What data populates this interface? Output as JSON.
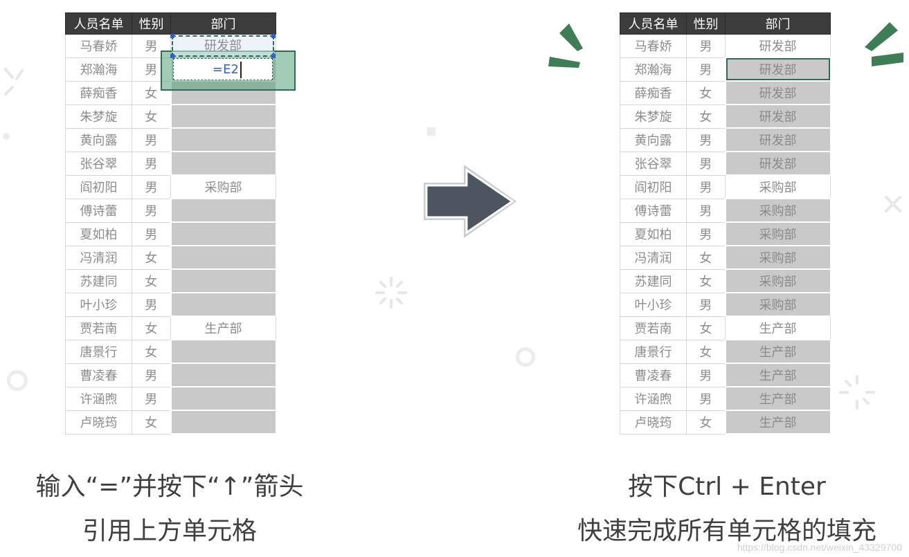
{
  "headers": [
    "人员名单",
    "性别",
    "部门"
  ],
  "left_rows": [
    {
      "name": "马春娇",
      "sex": "男",
      "dept": "研发部"
    },
    {
      "name": "郑瀚海",
      "sex": "男",
      "dept": ""
    },
    {
      "name": "薛痴香",
      "sex": "女",
      "dept": ""
    },
    {
      "name": "朱梦旋",
      "sex": "女",
      "dept": ""
    },
    {
      "name": "黄向露",
      "sex": "男",
      "dept": ""
    },
    {
      "name": "张谷翠",
      "sex": "男",
      "dept": ""
    },
    {
      "name": "阎初阳",
      "sex": "男",
      "dept": "采购部"
    },
    {
      "name": "傅诗蕾",
      "sex": "男",
      "dept": ""
    },
    {
      "name": "夏如柏",
      "sex": "男",
      "dept": ""
    },
    {
      "name": "冯清润",
      "sex": "女",
      "dept": ""
    },
    {
      "name": "苏建同",
      "sex": "女",
      "dept": ""
    },
    {
      "name": "叶小珍",
      "sex": "男",
      "dept": ""
    },
    {
      "name": "贾若南",
      "sex": "女",
      "dept": "生产部"
    },
    {
      "name": "唐景行",
      "sex": "女",
      "dept": ""
    },
    {
      "name": "曹凌春",
      "sex": "男",
      "dept": ""
    },
    {
      "name": "许涵煦",
      "sex": "男",
      "dept": ""
    },
    {
      "name": "卢晓筠",
      "sex": "女",
      "dept": ""
    }
  ],
  "right_rows": [
    {
      "name": "马春娇",
      "sex": "男",
      "dept": "研发部"
    },
    {
      "name": "郑瀚海",
      "sex": "男",
      "dept": "研发部"
    },
    {
      "name": "薛痴香",
      "sex": "女",
      "dept": "研发部"
    },
    {
      "name": "朱梦旋",
      "sex": "女",
      "dept": "研发部"
    },
    {
      "name": "黄向露",
      "sex": "男",
      "dept": "研发部"
    },
    {
      "name": "张谷翠",
      "sex": "男",
      "dept": "研发部"
    },
    {
      "name": "阎初阳",
      "sex": "男",
      "dept": "采购部"
    },
    {
      "name": "傅诗蕾",
      "sex": "男",
      "dept": "采购部"
    },
    {
      "name": "夏如柏",
      "sex": "男",
      "dept": "采购部"
    },
    {
      "name": "冯清润",
      "sex": "女",
      "dept": "采购部"
    },
    {
      "name": "苏建同",
      "sex": "女",
      "dept": "采购部"
    },
    {
      "name": "叶小珍",
      "sex": "男",
      "dept": "采购部"
    },
    {
      "name": "贾若南",
      "sex": "女",
      "dept": "生产部"
    },
    {
      "name": "唐景行",
      "sex": "女",
      "dept": "生产部"
    },
    {
      "name": "曹凌春",
      "sex": "男",
      "dept": "生产部"
    },
    {
      "name": "许涵煦",
      "sex": "男",
      "dept": "生产部"
    },
    {
      "name": "卢晓筠",
      "sex": "女",
      "dept": "生产部"
    }
  ],
  "formula": "=E2",
  "left_caption": {
    "line1": "输入“=”并按下“↑”箭头",
    "line2": "引用上方单元格"
  },
  "right_caption": {
    "line1": "按下Ctrl + Enter",
    "line2": "快速完成所有单元格的填充"
  },
  "watermark": "https://blog.csdn.net/weixin_43329700",
  "colors": {
    "header": "#3c3c3c",
    "fill": "#c9c9c9",
    "accent": "#2e6b52",
    "arrow": "#4d5561"
  }
}
